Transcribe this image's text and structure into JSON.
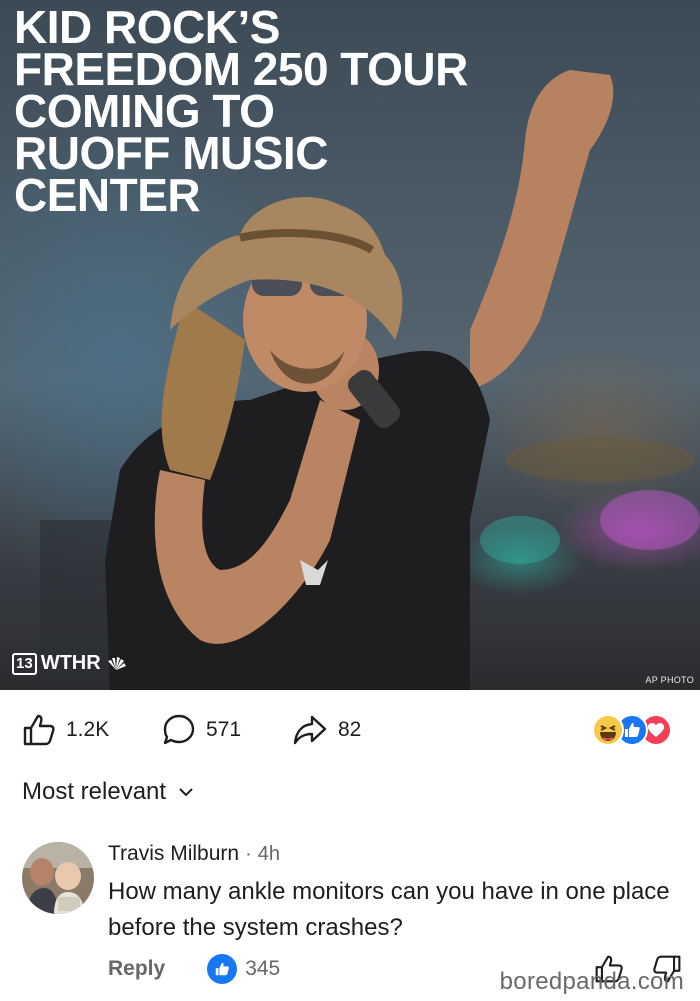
{
  "post": {
    "headline_lines": [
      "KID ROCK’S",
      "FREEDOM 250 TOUR",
      "COMING TO",
      "RUOFF MUSIC",
      "CENTER"
    ],
    "logo_number": "13",
    "logo_text": "WTHR",
    "photo_credit": "AP PHOTO"
  },
  "actions": {
    "likes": "1.2K",
    "comments": "571",
    "shares": "82",
    "reaction_icons": [
      "haha-icon",
      "like-icon",
      "love-icon"
    ]
  },
  "sort": {
    "label": "Most relevant"
  },
  "comment": {
    "author": "Travis Milburn",
    "separator": "·",
    "time": "4h",
    "text": "How many ankle monitors can you have in one place before the system crashes?",
    "reply_label": "Reply",
    "like_count": "345"
  },
  "watermark": "boredpanda.com",
  "colors": {
    "accent_blue": "#1877f2",
    "love_red": "#f33e58",
    "haha_yellow": "#f7c948",
    "secondary_text": "#65676b"
  }
}
